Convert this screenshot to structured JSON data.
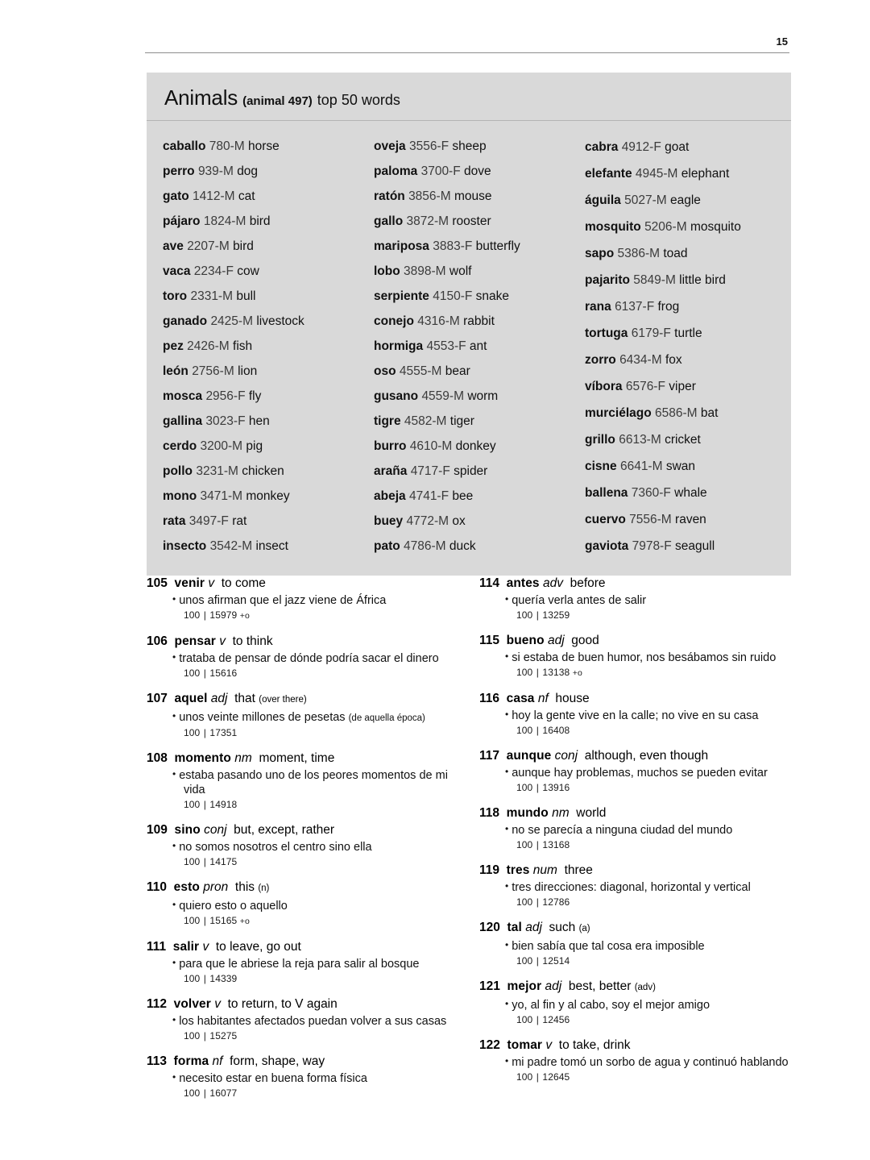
{
  "page": {
    "folio": "15"
  },
  "theme_box": {
    "title": "Animals",
    "code": "(animal 497)",
    "subtitle": "top 50 words",
    "columns": [
      [
        {
          "word": "caballo",
          "rank": "780-M",
          "gloss": "horse"
        },
        {
          "word": "perro",
          "rank": "939-M",
          "gloss": "dog"
        },
        {
          "word": "gato",
          "rank": "1412-M",
          "gloss": "cat"
        },
        {
          "word": "pájaro",
          "rank": "1824-M",
          "gloss": "bird"
        },
        {
          "word": "ave",
          "rank": "2207-M",
          "gloss": "bird"
        },
        {
          "word": "vaca",
          "rank": "2234-F",
          "gloss": "cow"
        },
        {
          "word": "toro",
          "rank": "2331-M",
          "gloss": "bull"
        },
        {
          "word": "ganado",
          "rank": "2425-M",
          "gloss": "livestock"
        },
        {
          "word": "pez",
          "rank": "2426-M",
          "gloss": "fish"
        },
        {
          "word": "león",
          "rank": "2756-M",
          "gloss": "lion"
        },
        {
          "word": "mosca",
          "rank": "2956-F",
          "gloss": "fly"
        },
        {
          "word": "gallina",
          "rank": "3023-F",
          "gloss": "hen"
        },
        {
          "word": "cerdo",
          "rank": "3200-M",
          "gloss": "pig"
        },
        {
          "word": "pollo",
          "rank": "3231-M",
          "gloss": "chicken"
        },
        {
          "word": "mono",
          "rank": "3471-M",
          "gloss": "monkey"
        },
        {
          "word": "rata",
          "rank": "3497-F",
          "gloss": "rat"
        },
        {
          "word": "insecto",
          "rank": "3542-M",
          "gloss": "insect"
        }
      ],
      [
        {
          "word": "oveja",
          "rank": "3556-F",
          "gloss": "sheep"
        },
        {
          "word": "paloma",
          "rank": "3700-F",
          "gloss": "dove"
        },
        {
          "word": "ratón",
          "rank": "3856-M",
          "gloss": "mouse"
        },
        {
          "word": "gallo",
          "rank": "3872-M",
          "gloss": "rooster"
        },
        {
          "word": "mariposa",
          "rank": "3883-F",
          "gloss": "butterfly"
        },
        {
          "word": "lobo",
          "rank": "3898-M",
          "gloss": "wolf"
        },
        {
          "word": "serpiente",
          "rank": "4150-F",
          "gloss": "snake"
        },
        {
          "word": "conejo",
          "rank": "4316-M",
          "gloss": "rabbit"
        },
        {
          "word": "hormiga",
          "rank": "4553-F",
          "gloss": "ant"
        },
        {
          "word": "oso",
          "rank": "4555-M",
          "gloss": "bear"
        },
        {
          "word": "gusano",
          "rank": "4559-M",
          "gloss": "worm"
        },
        {
          "word": "tigre",
          "rank": "4582-M",
          "gloss": "tiger"
        },
        {
          "word": "burro",
          "rank": "4610-M",
          "gloss": "donkey"
        },
        {
          "word": "araña",
          "rank": "4717-F",
          "gloss": "spider"
        },
        {
          "word": "abeja",
          "rank": "4741-F",
          "gloss": "bee"
        },
        {
          "word": "buey",
          "rank": "4772-M",
          "gloss": "ox"
        },
        {
          "word": "pato",
          "rank": "4786-M",
          "gloss": "duck"
        }
      ],
      [
        {
          "word": "cabra",
          "rank": "4912-F",
          "gloss": "goat"
        },
        {
          "word": "elefante",
          "rank": "4945-M",
          "gloss": "elephant"
        },
        {
          "word": "águila",
          "rank": "5027-M",
          "gloss": "eagle"
        },
        {
          "word": "mosquito",
          "rank": "5206-M",
          "gloss": "mosquito"
        },
        {
          "word": "sapo",
          "rank": "5386-M",
          "gloss": "toad"
        },
        {
          "word": "pajarito",
          "rank": "5849-M",
          "gloss": "little bird"
        },
        {
          "word": "rana",
          "rank": "6137-F",
          "gloss": "frog"
        },
        {
          "word": "tortuga",
          "rank": "6179-F",
          "gloss": "turtle"
        },
        {
          "word": "zorro",
          "rank": "6434-M",
          "gloss": "fox"
        },
        {
          "word": "víbora",
          "rank": "6576-F",
          "gloss": "viper"
        },
        {
          "word": "murciélago",
          "rank": "6586-M",
          "gloss": "bat"
        },
        {
          "word": "grillo",
          "rank": "6613-M",
          "gloss": "cricket"
        },
        {
          "word": "cisne",
          "rank": "6641-M",
          "gloss": "swan"
        },
        {
          "word": "ballena",
          "rank": "7360-F",
          "gloss": "whale"
        },
        {
          "word": "cuervo",
          "rank": "7556-M",
          "gloss": "raven"
        },
        {
          "word": "gaviota",
          "rank": "7978-F",
          "gloss": "seagull"
        }
      ]
    ]
  },
  "entries": {
    "left": [
      {
        "rank": "105",
        "word": "venir",
        "pos": "v",
        "gloss": "to come",
        "note": "",
        "example": "unos afirman que el jazz viene de África",
        "example_note": "",
        "stat_range": "100",
        "stat_freq": "15979",
        "stat_flag": "+o"
      },
      {
        "rank": "106",
        "word": "pensar",
        "pos": "v",
        "gloss": "to think",
        "note": "",
        "example": "trataba de pensar de dónde podría sacar el dinero",
        "example_note": "",
        "stat_range": "100",
        "stat_freq": "15616",
        "stat_flag": ""
      },
      {
        "rank": "107",
        "word": "aquel",
        "pos": "adj",
        "gloss": "that",
        "note": "(over there)",
        "example": "unos veinte millones de pesetas",
        "example_note": "(de aquella época)",
        "stat_range": "100",
        "stat_freq": "17351",
        "stat_flag": ""
      },
      {
        "rank": "108",
        "word": "momento",
        "pos": "nm",
        "gloss": "moment, time",
        "note": "",
        "example": "estaba pasando uno de los peores momentos de mi vida",
        "example_note": "",
        "stat_range": "100",
        "stat_freq": "14918",
        "stat_flag": ""
      },
      {
        "rank": "109",
        "word": "sino",
        "pos": "conj",
        "gloss": "but, except, rather",
        "note": "",
        "example": "no somos nosotros el centro sino ella",
        "example_note": "",
        "stat_range": "100",
        "stat_freq": "14175",
        "stat_flag": ""
      },
      {
        "rank": "110",
        "word": "esto",
        "pos": "pron",
        "gloss": "this",
        "note": "(n)",
        "example": "quiero esto o aquello",
        "example_note": "",
        "stat_range": "100",
        "stat_freq": "15165",
        "stat_flag": "+o"
      },
      {
        "rank": "111",
        "word": "salir",
        "pos": "v",
        "gloss": "to leave, go out",
        "note": "",
        "example": "para que le abriese la reja para salir al bosque",
        "example_note": "",
        "stat_range": "100",
        "stat_freq": "14339",
        "stat_flag": ""
      },
      {
        "rank": "112",
        "word": "volver",
        "pos": "v",
        "gloss": "to return, to V again",
        "note": "",
        "example": "los habitantes afectados puedan volver a sus casas",
        "example_note": "",
        "stat_range": "100",
        "stat_freq": "15275",
        "stat_flag": ""
      },
      {
        "rank": "113",
        "word": "forma",
        "pos": "nf",
        "gloss": "form, shape, way",
        "note": "",
        "example": "necesito estar en buena forma física",
        "example_note": "",
        "stat_range": "100",
        "stat_freq": "16077",
        "stat_flag": ""
      }
    ],
    "right": [
      {
        "rank": "114",
        "word": "antes",
        "pos": "adv",
        "gloss": "before",
        "note": "",
        "example": "quería verla antes de salir",
        "example_note": "",
        "stat_range": "100",
        "stat_freq": "13259",
        "stat_flag": ""
      },
      {
        "rank": "115",
        "word": "bueno",
        "pos": "adj",
        "gloss": "good",
        "note": "",
        "example": "si estaba de buen humor, nos besábamos sin ruido",
        "example_note": "",
        "stat_range": "100",
        "stat_freq": "13138",
        "stat_flag": "+o"
      },
      {
        "rank": "116",
        "word": "casa",
        "pos": "nf",
        "gloss": "house",
        "note": "",
        "example": "hoy la gente vive en la calle; no vive en su casa",
        "example_note": "",
        "stat_range": "100",
        "stat_freq": "16408",
        "stat_flag": ""
      },
      {
        "rank": "117",
        "word": "aunque",
        "pos": "conj",
        "gloss": "although, even though",
        "note": "",
        "example": "aunque hay problemas, muchos se pueden evitar",
        "example_note": "",
        "stat_range": "100",
        "stat_freq": "13916",
        "stat_flag": ""
      },
      {
        "rank": "118",
        "word": "mundo",
        "pos": "nm",
        "gloss": "world",
        "note": "",
        "example": "no se parecía a ninguna ciudad del mundo",
        "example_note": "",
        "stat_range": "100",
        "stat_freq": "13168",
        "stat_flag": ""
      },
      {
        "rank": "119",
        "word": "tres",
        "pos": "num",
        "gloss": "three",
        "note": "",
        "example": "tres direcciones: diagonal, horizontal y vertical",
        "example_note": "",
        "stat_range": "100",
        "stat_freq": "12786",
        "stat_flag": ""
      },
      {
        "rank": "120",
        "word": "tal",
        "pos": "adj",
        "gloss": "such",
        "note": "(a)",
        "example": "bien sabía que tal cosa era imposible",
        "example_note": "",
        "stat_range": "100",
        "stat_freq": "12514",
        "stat_flag": ""
      },
      {
        "rank": "121",
        "word": "mejor",
        "pos": "adj",
        "gloss": "best, better",
        "note": "(adv)",
        "example": "yo, al fin y al cabo, soy el mejor amigo",
        "example_note": "",
        "stat_range": "100",
        "stat_freq": "12456",
        "stat_flag": ""
      },
      {
        "rank": "122",
        "word": "tomar",
        "pos": "v",
        "gloss": "to take, drink",
        "note": "",
        "example": "mi padre tomó un sorbo de agua y continuó hablando",
        "example_note": "",
        "stat_range": "100",
        "stat_freq": "12645",
        "stat_flag": ""
      }
    ]
  }
}
